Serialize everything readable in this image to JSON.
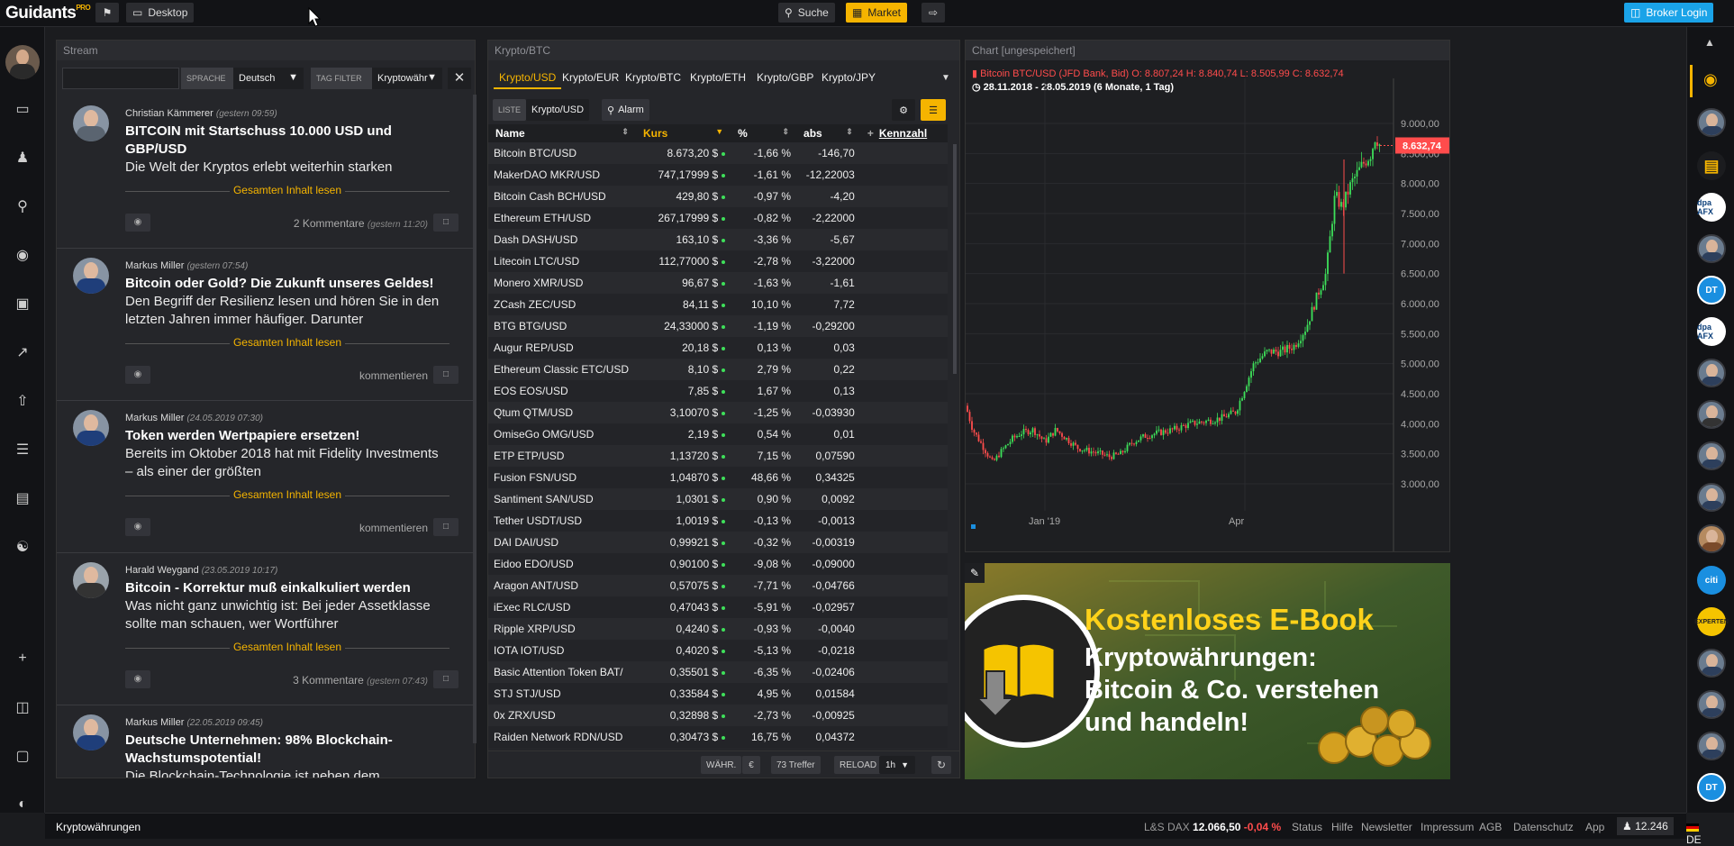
{
  "header": {
    "logo": "Guidants",
    "logo_badge": "PRO",
    "desktop_label": "Desktop",
    "search_label": "Suche",
    "market_label": "Market",
    "broker_login": "Broker Login"
  },
  "stream": {
    "title": "Stream",
    "lang_label": "SPRACHE",
    "lang_value": "Deutsch",
    "tag_label": "TAG FILTER",
    "tag_value": "Kryptowähr",
    "posts": [
      {
        "author": "Christian Kämmerer",
        "time": "(gestern 09:59)",
        "title": "BITCOIN mit Startschuss 10.000 USD und GBP/USD",
        "text": "Die Welt der Kryptos erlebt weiterhin starken",
        "read": "Gesamten Inhalt lesen",
        "comments": "2 Kommentare",
        "ctime": "(gestern 11:20)"
      },
      {
        "author": "Markus Miller",
        "time": "(gestern 07:54)",
        "title": "Bitcoin oder Gold? Die Zukunft unseres Geldes!",
        "text": "Den Begriff der Resilienz lesen und hören Sie in den letzten Jahren immer häufiger. Darunter",
        "read": "Gesamten Inhalt lesen",
        "comments": "kommentieren",
        "ctime": ""
      },
      {
        "author": "Markus Miller",
        "time": "(24.05.2019 07:30)",
        "title": "Token werden Wertpapiere ersetzen!",
        "text": "Bereits im Oktober 2018 hat mit Fidelity Investments – als einer der größten",
        "read": "Gesamten Inhalt lesen",
        "comments": "kommentieren",
        "ctime": ""
      },
      {
        "author": "Harald Weygand",
        "time": "(23.05.2019 10:17)",
        "title": "Bitcoin - Korrektur muß einkalkuliert werden",
        "text": "Was nicht ganz unwichtig ist: Bei jeder Assetklasse sollte man schauen, wer Wortführer",
        "read": "Gesamten Inhalt lesen",
        "comments": "3 Kommentare",
        "ctime": "(gestern 07:43)"
      },
      {
        "author": "Markus Miller",
        "time": "(22.05.2019 09:45)",
        "title": "Deutsche Unternehmen: 98% Blockchain-Wachstumspotential!",
        "text": "Die Blockchain-Technologie ist neben dem",
        "read": "",
        "comments": "",
        "ctime": ""
      }
    ]
  },
  "crypto": {
    "title": "Krypto/BTC",
    "tabs": [
      "Krypto/USD",
      "Krypto/EUR",
      "Krypto/BTC",
      "Krypto/ETH",
      "Krypto/GBP",
      "Krypto/JPY"
    ],
    "liste_label": "LISTE",
    "liste_value": "Krypto/USD",
    "alarm_label": "Alarm",
    "columns": [
      "Name",
      "Kurs",
      "%",
      "abs",
      "Kennzahl"
    ],
    "rows": [
      [
        "Bitcoin BTC/USD",
        "8.673,20 $",
        "-1,66 %",
        "-146,70"
      ],
      [
        "MakerDAO MKR/USD",
        "747,17999 $",
        "-1,61 %",
        "-12,22003"
      ],
      [
        "Bitcoin Cash BCH/USD",
        "429,80 $",
        "-0,97 %",
        "-4,20"
      ],
      [
        "Ethereum ETH/USD",
        "267,17999 $",
        "-0,82 %",
        "-2,22000"
      ],
      [
        "Dash DASH/USD",
        "163,10 $",
        "-3,36 %",
        "-5,67"
      ],
      [
        "Litecoin LTC/USD",
        "112,77000 $",
        "-2,78 %",
        "-3,22000"
      ],
      [
        "Monero XMR/USD",
        "96,67 $",
        "-1,63 %",
        "-1,61"
      ],
      [
        "ZCash ZEC/USD",
        "84,11 $",
        "10,10 %",
        "7,72"
      ],
      [
        "BTG BTG/USD",
        "24,33000 $",
        "-1,19 %",
        "-0,29200"
      ],
      [
        "Augur REP/USD",
        "20,18 $",
        "0,13 %",
        "0,03"
      ],
      [
        "Ethereum Classic ETC/USD",
        "8,10 $",
        "2,79 %",
        "0,22"
      ],
      [
        "EOS EOS/USD",
        "7,85 $",
        "1,67 %",
        "0,13"
      ],
      [
        "Qtum QTM/USD",
        "3,10070 $",
        "-1,25 %",
        "-0,03930"
      ],
      [
        "OmiseGo OMG/USD",
        "2,19 $",
        "0,54 %",
        "0,01"
      ],
      [
        "ETP ETP/USD",
        "1,13720 $",
        "7,15 %",
        "0,07590"
      ],
      [
        "Fusion FSN/USD",
        "1,04870 $",
        "48,66 %",
        "0,34325"
      ],
      [
        "Santiment SAN/USD",
        "1,0301 $",
        "0,90 %",
        "0,0092"
      ],
      [
        "Tether USDT/USD",
        "1,0019 $",
        "-0,13 %",
        "-0,0013"
      ],
      [
        "DAI DAI/USD",
        "0,99921 $",
        "-0,32 %",
        "-0,00319"
      ],
      [
        "Eidoo EDO/USD",
        "0,90100 $",
        "-9,08 %",
        "-0,09000"
      ],
      [
        "Aragon ANT/USD",
        "0,57075 $",
        "-7,71 %",
        "-0,04766"
      ],
      [
        "iExec RLC/USD",
        "0,47043 $",
        "-5,91 %",
        "-0,02957"
      ],
      [
        "Ripple XRP/USD",
        "0,4240 $",
        "-0,93 %",
        "-0,0040"
      ],
      [
        "IOTA IOT/USD",
        "0,4020 $",
        "-5,13 %",
        "-0,0218"
      ],
      [
        "Basic Attention Token BAT/",
        "0,35501 $",
        "-6,35 %",
        "-0,02406"
      ],
      [
        "STJ STJ/USD",
        "0,33584 $",
        "4,95 %",
        "0,01584"
      ],
      [
        "0x ZRX/USD",
        "0,32898 $",
        "-2,73 %",
        "-0,00925"
      ],
      [
        "Raiden Network RDN/USD",
        "0,30473 $",
        "16,75 %",
        "0,04372"
      ]
    ],
    "footer": {
      "waehr": "WÄHR.",
      "currency": "€",
      "hits": "73 Treffer",
      "reload": "RELOAD",
      "interval": "1h"
    }
  },
  "chart": {
    "title": "Chart [ungespeichert]",
    "info": "Bitcoin BTC/USD (JFD Bank, Bid)  O: 8.807,24  H: 8.840,74  L: 8.505,99  C: 8.632,74",
    "range": "28.11.2018 - 28.05.2019  (6 Monate, 1 Tag)",
    "price_tag": "8.632,74",
    "y_ticks": [
      "9.000,00",
      "8.500,00",
      "8.000,00",
      "7.500,00",
      "7.000,00",
      "6.500,00",
      "6.000,00",
      "5.500,00",
      "5.000,00",
      "4.500,00",
      "4.000,00",
      "3.500,00",
      "3.000,00"
    ],
    "x_ticks": [
      "Jan '19",
      "Apr"
    ]
  },
  "ad": {
    "line1": "Kostenloses E-Book",
    "line2": "Kryptowährungen:",
    "line3": "Bitcoin & Co. verstehen",
    "line4": "und handeln!"
  },
  "status": {
    "tab": "Kryptowährungen",
    "index_label": "L&S DAX",
    "index_value": "12.066,50",
    "index_change": "-0,04 %",
    "links": [
      "Status",
      "Hilfe",
      "Newsletter",
      "Impressum",
      "AGB",
      "Datenschutz",
      "App"
    ],
    "users": "12.246",
    "lang": "DE"
  },
  "colors": {
    "accent": "#f5b400",
    "up": "#3ee05a",
    "down": "#ff4c4c",
    "broker": "#1aa3e8"
  }
}
